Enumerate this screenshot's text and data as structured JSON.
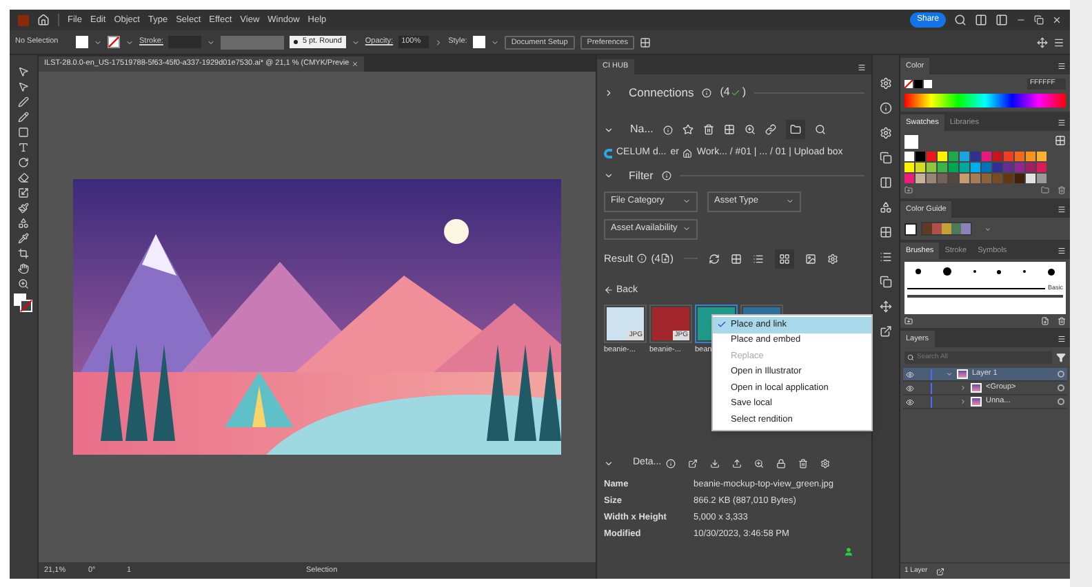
{
  "menubar": {
    "items": [
      "File",
      "Edit",
      "Object",
      "Type",
      "Select",
      "Effect",
      "View",
      "Window",
      "Help"
    ],
    "share": "Share"
  },
  "control_bar": {
    "selection": "No Selection",
    "stroke_label": "Stroke:",
    "brush": "5 pt. Round",
    "opacity_label": "Opacity:",
    "opacity": "100%",
    "style_label": "Style:",
    "buttons": [
      "Document Setup",
      "Preferences"
    ]
  },
  "document": {
    "tab_title": "ILST-28.0.0-en_US-17519788-5f63-45f0-a337-1929d01e7530.ai* @ 21,1 % (CMYK/Previe"
  },
  "status_bar": {
    "zoom": "21,1%",
    "rotation": "0°",
    "artboard": "1",
    "tool": "Selection"
  },
  "cihub": {
    "title": "CI HUB",
    "connections": {
      "label": "Connections",
      "count": "(4",
      "count_end": ")",
      "expanded": false
    },
    "navigation": {
      "label": "Na...",
      "expanded": true
    },
    "breadcrumb": {
      "source": "CELUM d...",
      "user": "er",
      "path": "Work... / #01 | ... / 01 | Upload box"
    },
    "filter": {
      "label": "Filter",
      "expanded": true,
      "dropdowns": [
        "File Category",
        "Asset Type",
        "Asset Availability"
      ]
    },
    "result": {
      "label": "Result",
      "count": "(4",
      "count_end": ")"
    },
    "back": "Back",
    "assets": [
      {
        "label": "beanie-...",
        "badge": "JPG",
        "color": "#cde2ee",
        "selected": false
      },
      {
        "label": "beanie-...",
        "badge": "JPG",
        "color": "#a3262b",
        "selected": false
      },
      {
        "label": "bean",
        "color": "#1f9a8a",
        "selected": true
      },
      {
        "color": "#2f6f9c",
        "selected": false
      }
    ],
    "context_menu": [
      {
        "label": "Place and link",
        "checked": true,
        "highlighted": true,
        "disabled": false
      },
      {
        "label": "Place and embed",
        "checked": false,
        "highlighted": false,
        "disabled": false
      },
      {
        "label": "Replace",
        "checked": false,
        "highlighted": false,
        "disabled": true
      },
      {
        "label": "Open in Illustrator",
        "checked": false,
        "highlighted": false,
        "disabled": false
      },
      {
        "label": "Open in local application",
        "checked": false,
        "highlighted": false,
        "disabled": false
      },
      {
        "label": "Save local",
        "checked": false,
        "highlighted": false,
        "disabled": false
      },
      {
        "label": "Select rendition",
        "checked": false,
        "highlighted": false,
        "disabled": false
      }
    ],
    "details": {
      "label": "Deta...",
      "expanded": true,
      "rows": [
        {
          "key": "Name",
          "value": "beanie-mockup-top-view_green.jpg"
        },
        {
          "key": "Size",
          "value": "866.2 KB (887,010 Bytes)"
        },
        {
          "key": "Width x Height",
          "value": "5,000 x 3,333"
        },
        {
          "key": "Modified",
          "value": "10/30/2023, 3:46:58 PM"
        }
      ]
    }
  },
  "color_panel": {
    "title": "Color",
    "hex": "FFFFFF"
  },
  "swatches_panel": {
    "tabs": [
      {
        "label": "Swatches",
        "selected": true
      },
      {
        "label": "Libraries",
        "selected": false
      }
    ],
    "swatches": [
      {
        "color": "#ffffff"
      },
      {
        "color": "#000000"
      },
      {
        "color": "#e8191d"
      },
      {
        "color": "#fff200"
      },
      {
        "color": "#1fa84a"
      },
      {
        "color": "#1aa3e0"
      },
      {
        "color": "#2e3190"
      },
      {
        "color": "#e6197d"
      },
      {
        "color": "#c4161c"
      },
      {
        "color": "#ef3e23"
      },
      {
        "color": "#f26a22"
      },
      {
        "color": "#f7941d"
      },
      {
        "color": "#f9b233"
      },
      {
        "color": "#fff200"
      },
      {
        "color": "#d6de23"
      },
      {
        "color": "#8dc63f"
      },
      {
        "color": "#39b54a"
      },
      {
        "color": "#00a651"
      },
      {
        "color": "#00a99d"
      },
      {
        "color": "#00aeef"
      },
      {
        "color": "#0072bc"
      },
      {
        "color": "#2e3192"
      },
      {
        "color": "#662d91"
      },
      {
        "color": "#92278f"
      },
      {
        "color": "#9e1f63"
      },
      {
        "color": "#d91c5c"
      },
      {
        "color": "#ed1e79"
      },
      {
        "color": "#c7b299"
      },
      {
        "color": "#998675"
      },
      {
        "color": "#736357"
      },
      {
        "color": "#534741"
      },
      {
        "color": "#c69c6d"
      },
      {
        "color": "#a67c52"
      },
      {
        "color": "#8c6239"
      },
      {
        "color": "#754c24"
      },
      {
        "color": "#603913"
      },
      {
        "color": "#42210b"
      },
      {
        "color": "#e2e2e2"
      },
      {
        "color": "#9a9a9a"
      }
    ]
  },
  "color_guide": {
    "title": "Color Guide",
    "colors": [
      {
        "color": "#5e3a24"
      },
      {
        "color": "#b0504a"
      },
      {
        "color": "#c4a23a"
      },
      {
        "color": "#4e7a5a"
      },
      {
        "color": "#8a82b8"
      }
    ]
  },
  "brushes_panel": {
    "tabs": [
      {
        "label": "Brushes",
        "selected": true
      },
      {
        "label": "Stroke",
        "selected": false
      },
      {
        "label": "Symbols",
        "selected": false
      }
    ],
    "basic_label": "Basic"
  },
  "layers_panel": {
    "title": "Layers",
    "search_placeholder": "Search All",
    "layers": [
      {
        "name": "Layer 1",
        "expanded": true,
        "selected": true,
        "children": [
          {
            "name": "<Group>",
            "expanded": false,
            "selected": false
          },
          {
            "name": "Unna...",
            "expanded": false,
            "selected": false
          }
        ]
      }
    ],
    "footer": "1 Layer"
  }
}
